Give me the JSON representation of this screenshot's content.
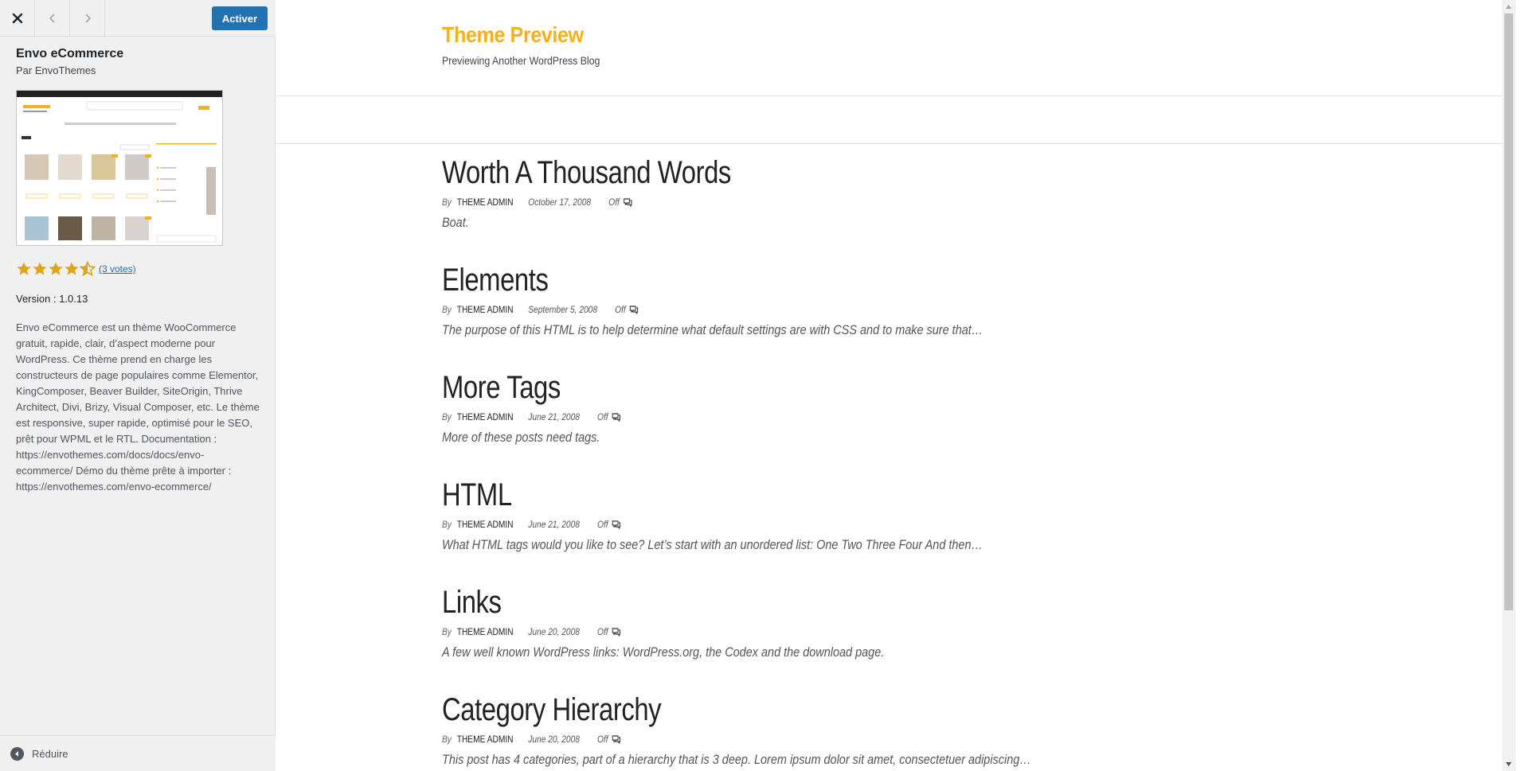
{
  "toolbar": {
    "close_icon": "close-icon",
    "prev_icon": "chevron-left-icon",
    "next_icon": "chevron-right-icon",
    "activate_label": "Activer"
  },
  "theme": {
    "name": "Envo eCommerce",
    "author": "Par EnvoThemes",
    "rating_value": 4.5,
    "votes_label": "(3 votes)",
    "version": "Version : 1.0.13",
    "description": "Envo eCommerce est un thème WooCommerce gratuit, rapide, clair, d’aspect moderne pour WordPress. Ce thème prend en charge les constructeurs de page populaires comme Elementor, KingComposer, Beaver Builder, SiteOrigin, Thrive Architect, Divi, Brizy, Visual Composer, etc. Le thème est responsive, super rapide, optimisé pour le SEO, prêt pour WPML et le RTL. Documentation : https://envothemes.com/docs/docs/envo-ecommerce/ Démo du thème prête à importer : https://envothemes.com/envo-ecommerce/"
  },
  "collapse": {
    "label": "Réduire"
  },
  "site": {
    "title": "Theme Preview",
    "tagline": "Previewing Another WordPress Blog",
    "accent_color": "#f5b01e"
  },
  "posts": [
    {
      "title": "Worth A Thousand Words",
      "by": "By",
      "author": "THEME ADMIN",
      "date": "October 17, 2008",
      "comments": "Off",
      "excerpt": "Boat."
    },
    {
      "title": "Elements",
      "by": "By",
      "author": "THEME ADMIN",
      "date": "September 5, 2008",
      "comments": "Off",
      "excerpt": "The purpose of this HTML is to help determine what default settings are with CSS and to make sure that…"
    },
    {
      "title": "More Tags",
      "by": "By",
      "author": "THEME ADMIN",
      "date": "June 21, 2008",
      "comments": "Off",
      "excerpt": "More of these posts need tags."
    },
    {
      "title": "HTML",
      "by": "By",
      "author": "THEME ADMIN",
      "date": "June 21, 2008",
      "comments": "Off",
      "excerpt": "What HTML tags would you like to see? Let’s start with an unordered list: One Two Three Four And then…"
    },
    {
      "title": "Links",
      "by": "By",
      "author": "THEME ADMIN",
      "date": "June 20, 2008",
      "comments": "Off",
      "excerpt": "A few well known WordPress links: WordPress.org, the Codex and the download page."
    },
    {
      "title": "Category Hierarchy",
      "by": "By",
      "author": "THEME ADMIN",
      "date": "June 20, 2008",
      "comments": "Off",
      "excerpt": "This post has 4 categories, part of a hierarchy that is 3 deep. Lorem ipsum dolor sit amet, consectetuer adipiscing…"
    }
  ],
  "colors": {
    "primary_button": "#2271b1",
    "sidebar_bg": "#f0f0f1",
    "star": "#dba617"
  }
}
